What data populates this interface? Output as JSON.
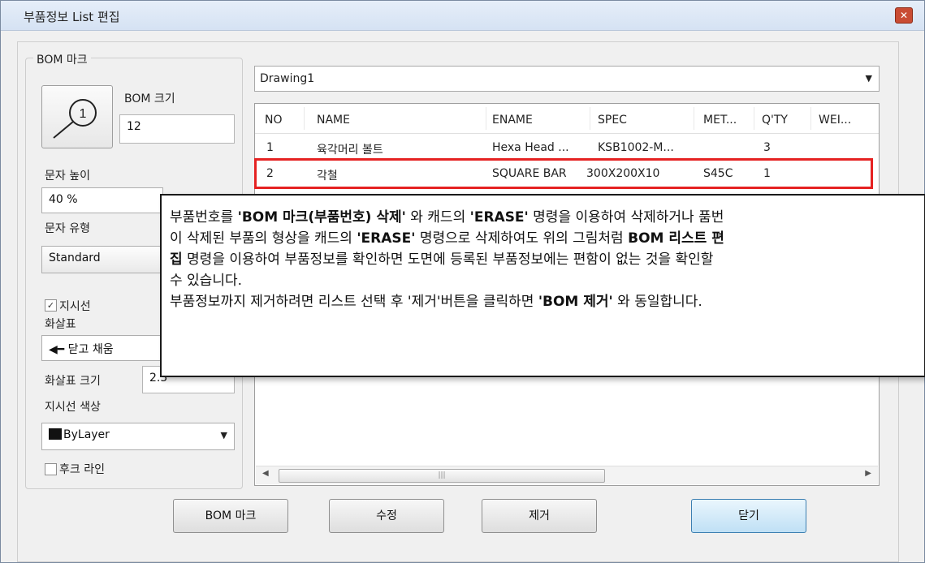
{
  "window": {
    "title": "부품정보 List 편집",
    "close_glyph": "✕"
  },
  "bom_mark": {
    "group_label": "BOM 마크",
    "size_label": "BOM 크기",
    "size_value": "12",
    "icon_number": "1",
    "text_height_label": "문자 높이",
    "text_height_value": "40 %",
    "text_style_label": "문자 유형",
    "text_style_value": "Standard",
    "leader_checkbox_label": "지시선",
    "leader_checked": true,
    "arrow_label": "화살표",
    "arrow_value": "◀━ 닫고 채움",
    "arrow_size_label": "화살표 크기",
    "arrow_size_value": "2.5",
    "leader_color_label": "지시선 색상",
    "leader_color_value": "ByLayer",
    "leader_color_swatch": "#111111",
    "hook_line_label": "후크 라인",
    "hook_line_checked": false
  },
  "drawing_select": {
    "value": "Drawing1"
  },
  "parts_table": {
    "columns": [
      "NO",
      "NAME",
      "ENAME",
      "SPEC",
      "MET...",
      "Q'TY",
      "WEI..."
    ],
    "rows": [
      [
        "1",
        "육각머리 볼트",
        "Hexa Head ...",
        "KSB1002-M...",
        "",
        "3",
        ""
      ],
      [
        "2",
        "각철",
        "SQUARE BAR",
        "300X200X10",
        "S45C",
        "1",
        ""
      ]
    ],
    "highlight_color": "#e52222"
  },
  "buttons": {
    "bom_mark": "BOM 마크",
    "edit": "수정",
    "remove": "제거",
    "close": "닫기"
  },
  "callout": {
    "line1_a": "부품번호를 ",
    "line1_b": "'BOM 마크(부품번호) 삭제'",
    "line1_c": " 와 캐드의 ",
    "line1_d": "'ERASE'",
    "line1_e": " 명령을 이용하여 삭제하거나 품번",
    "line2_a": "이 삭제된 부품의 형상을 캐드의 ",
    "line2_b": "'ERASE'",
    "line2_c": " 명령으로 삭제하여도 위의 그림처럼 ",
    "line2_d": "BOM 리스트 편",
    "line3_a": "집",
    "line3_b": " 명령을 이용하여 부품정보를 확인하면 도면에 등록된 부품정보에는 편함이 없는 것을 확인할",
    "line4": "수 있습니다.",
    "line5_a": "부품정보까지 제거하려면 리스트 선택 후 '제거'버튼을 클릭하면 ",
    "line5_b": "'BOM 제거'",
    "line5_c": " 와 동일합니다."
  }
}
